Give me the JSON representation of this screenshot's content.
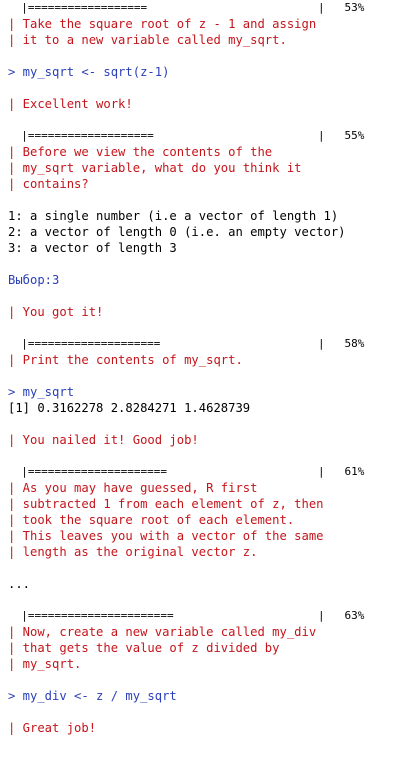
{
  "blocks": [
    {
      "type": "progress",
      "bar": "  |==================",
      "pct": "|   53%"
    },
    {
      "type": "msg",
      "lines": [
        "| Take the square root of z - 1 and assign",
        "| it to a new variable called my_sqrt."
      ]
    },
    {
      "type": "blank"
    },
    {
      "type": "cmd",
      "lines": [
        "> my_sqrt <- sqrt(z-1)"
      ]
    },
    {
      "type": "blank"
    },
    {
      "type": "msg",
      "lines": [
        "| Excellent work!"
      ]
    },
    {
      "type": "blank"
    },
    {
      "type": "progress",
      "bar": "  |===================",
      "pct": "|   55%"
    },
    {
      "type": "msg",
      "lines": [
        "| Before we view the contents of the",
        "| my_sqrt variable, what do you think it",
        "| contains?"
      ]
    },
    {
      "type": "blank"
    },
    {
      "type": "out",
      "lines": [
        "1: a single number (i.e a vector of length 1)",
        "2: a vector of length 0 (i.e. an empty vector)",
        "3: a vector of length 3"
      ]
    },
    {
      "type": "blank"
    },
    {
      "type": "sel",
      "lines": [
        "Выбор:3"
      ]
    },
    {
      "type": "blank"
    },
    {
      "type": "msg",
      "lines": [
        "| You got it!"
      ]
    },
    {
      "type": "blank"
    },
    {
      "type": "progress",
      "bar": "  |====================",
      "pct": "|   58%"
    },
    {
      "type": "msg",
      "lines": [
        "| Print the contents of my_sqrt."
      ]
    },
    {
      "type": "blank"
    },
    {
      "type": "cmd",
      "lines": [
        "> my_sqrt"
      ]
    },
    {
      "type": "out",
      "lines": [
        "[1] 0.3162278 2.8284271 1.4628739"
      ]
    },
    {
      "type": "blank"
    },
    {
      "type": "msg",
      "lines": [
        "| You nailed it! Good job!"
      ]
    },
    {
      "type": "blank"
    },
    {
      "type": "progress",
      "bar": "  |=====================",
      "pct": "|   61%"
    },
    {
      "type": "msg",
      "lines": [
        "| As you may have guessed, R first",
        "| subtracted 1 from each element of z, then",
        "| took the square root of each element.",
        "| This leaves you with a vector of the same",
        "| length as the original vector z."
      ]
    },
    {
      "type": "blank"
    },
    {
      "type": "out",
      "lines": [
        "..."
      ]
    },
    {
      "type": "blank"
    },
    {
      "type": "progress",
      "bar": "  |======================",
      "pct": "|   63%"
    },
    {
      "type": "msg",
      "lines": [
        "| Now, create a new variable called my_div",
        "| that gets the value of z divided by",
        "| my_sqrt."
      ]
    },
    {
      "type": "blank"
    },
    {
      "type": "cmd",
      "lines": [
        "> my_div <- z / my_sqrt"
      ]
    },
    {
      "type": "blank"
    },
    {
      "type": "msg",
      "lines": [
        "| Great job!"
      ]
    }
  ]
}
